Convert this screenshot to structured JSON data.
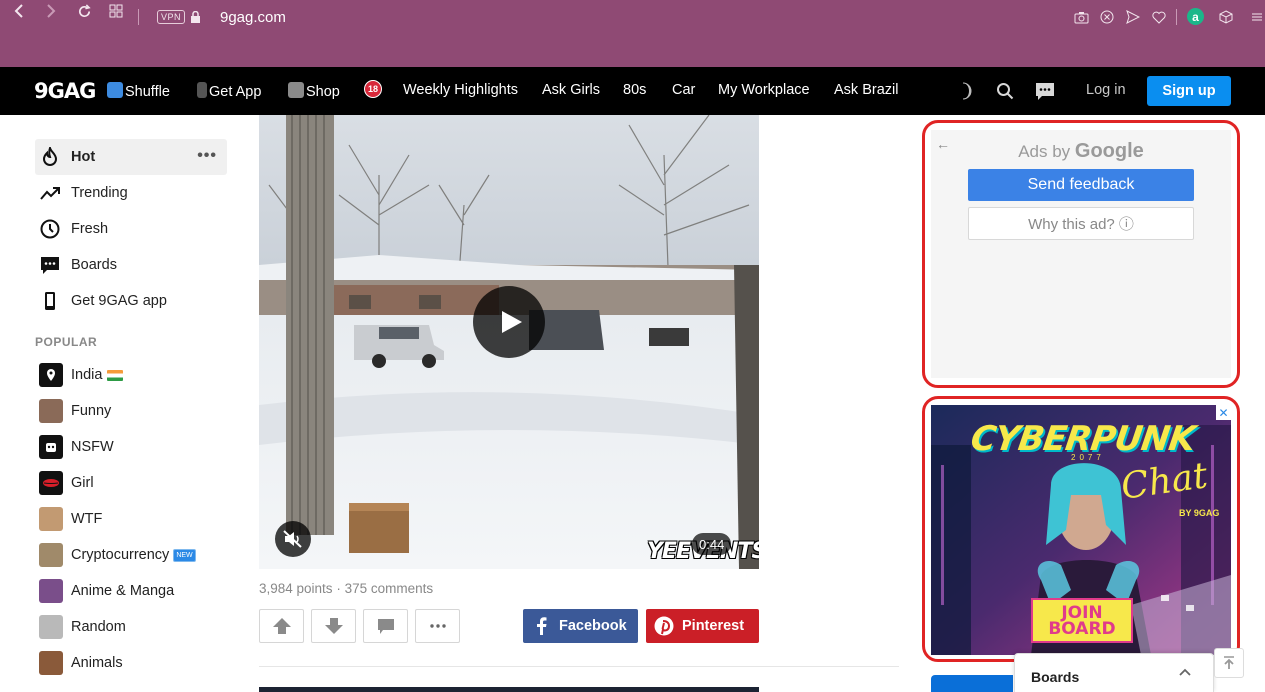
{
  "browser": {
    "vpn_label": "VPN",
    "url": "9gag.com"
  },
  "nav": {
    "logo": "9GAG",
    "items": [
      {
        "label": "Shuffle"
      },
      {
        "label": "Get App"
      },
      {
        "label": "Shop"
      },
      {
        "label": "Weekly Highlights"
      },
      {
        "label": "Ask Girls"
      },
      {
        "label": "80s"
      },
      {
        "label": "Car"
      },
      {
        "label": "My Workplace"
      },
      {
        "label": "Ask Brazil"
      }
    ],
    "login": "Log in",
    "signup": "Sign up"
  },
  "sidebar": {
    "main": [
      {
        "label": "Hot",
        "icon": "flame-icon"
      },
      {
        "label": "Trending",
        "icon": "trending-icon"
      },
      {
        "label": "Fresh",
        "icon": "clock-icon"
      },
      {
        "label": "Boards",
        "icon": "chat-icon"
      },
      {
        "label": "Get 9GAG app",
        "icon": "phone-icon"
      }
    ],
    "popular_heading": "POPULAR",
    "popular": [
      {
        "label": "India",
        "color": "#111111"
      },
      {
        "label": "Funny",
        "color": "#8a6a58"
      },
      {
        "label": "NSFW",
        "color": "#111111"
      },
      {
        "label": "Girl",
        "color": "#d81f2a"
      },
      {
        "label": "WTF",
        "color": "#c29a72"
      },
      {
        "label": "Cryptocurrency",
        "color": "#a08a6a"
      },
      {
        "label": "Anime & Manga",
        "color": "#7a4e8a"
      },
      {
        "label": "Random",
        "color": "#b9b9b9"
      },
      {
        "label": "Animals",
        "color": "#8a5a3a"
      }
    ],
    "new_badge": "NEW"
  },
  "post": {
    "duration": "0:44",
    "watermark": "YEEVENTS",
    "points": "3,984 points",
    "meta_sep": " · ",
    "comments": "375 comments",
    "share": {
      "facebook": "Facebook",
      "pinterest": "Pinterest"
    }
  },
  "ads": {
    "ads_by": "Ads by",
    "google": "Google",
    "send_feedback": "Send feedback",
    "why_this_ad": "Why this ad? ⓘ",
    "cyberpunk_title": "CYBERPUNK",
    "cyberpunk_year": "2077",
    "cyberpunk_chat": "Chat",
    "cyberpunk_by": "BY 9GAG",
    "join_line1": "JOIN",
    "join_line2": "BOARD"
  },
  "boards_panel": {
    "title": "Boards"
  },
  "colors": {
    "browser_bar": "#8f4a74",
    "signup": "#0a8ef0",
    "facebook": "#3b5998",
    "pinterest": "#cb1f27",
    "ad_highlight": "#e02424"
  }
}
